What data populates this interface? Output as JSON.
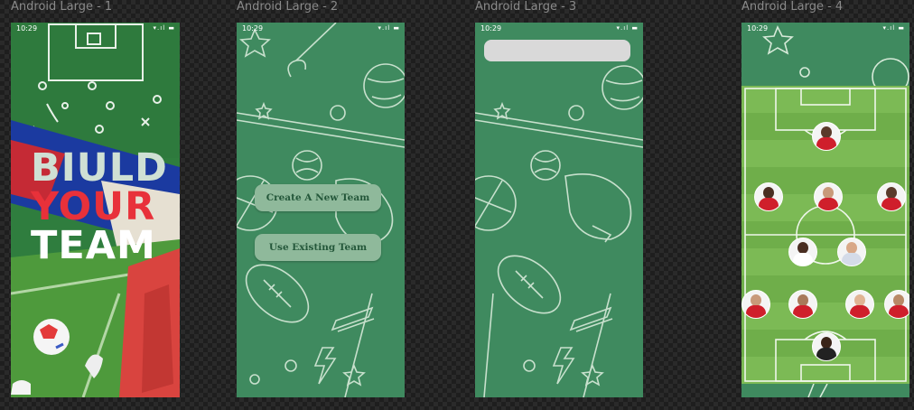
{
  "frames": [
    {
      "label": "Android Large - 1",
      "time": "10:29"
    },
    {
      "label": "Android Large - 2",
      "time": "10:29"
    },
    {
      "label": "Android Large - 3",
      "time": "10:29"
    },
    {
      "label": "Android Large - 4",
      "time": "10:29"
    }
  ],
  "status_icons": "wifi-icon signal-icon battery-icon",
  "status_glyphs": "▾.ıl ▬",
  "splash": {
    "line1": "BIULD",
    "line2": "YOUR",
    "line3": "TEAM"
  },
  "menu": {
    "create_label": "Create A New Team",
    "existing_label": "Use Existing Team"
  },
  "colors": {
    "chalkboard": "#3f8a5f",
    "button": "#8fb99b",
    "button_text": "#24573a",
    "pitch": "#6fae4a",
    "accent_red": "#e8313a"
  }
}
